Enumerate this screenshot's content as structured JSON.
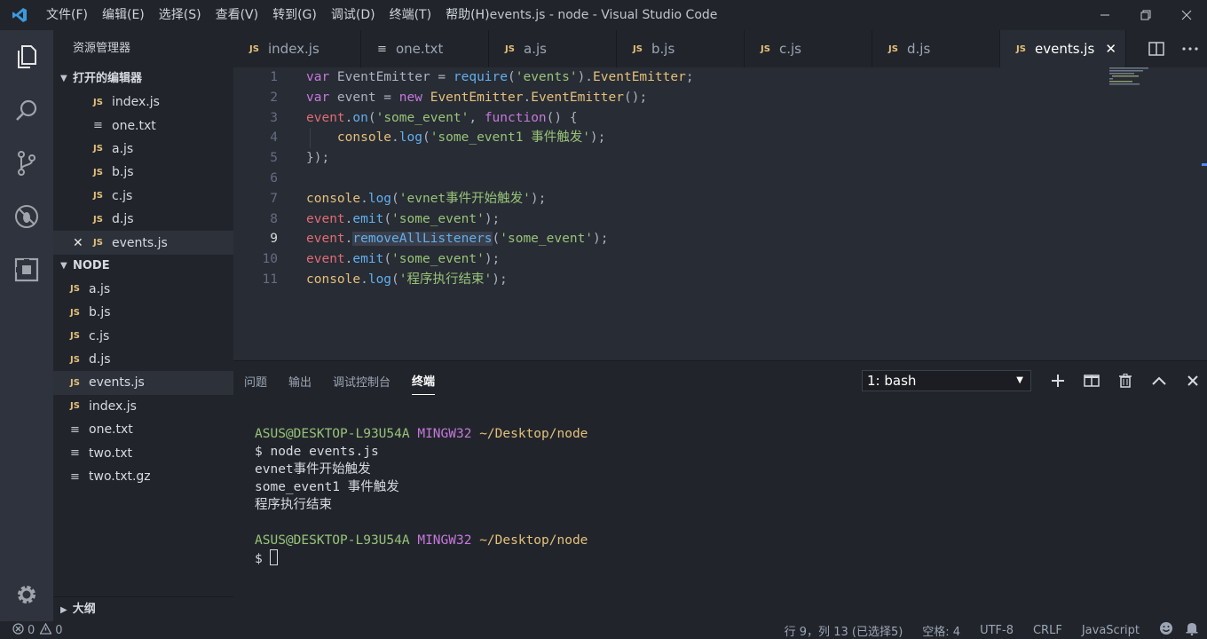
{
  "window": {
    "title": "events.js - node - Visual Studio Code",
    "menu": [
      "文件(F)",
      "编辑(E)",
      "选择(S)",
      "查看(V)",
      "转到(G)",
      "调试(D)",
      "终端(T)",
      "帮助(H)"
    ]
  },
  "sidebar": {
    "title": "资源管理器",
    "open_editors_label": "打开的编辑器",
    "open_editors": [
      {
        "label": "index.js",
        "type": "js"
      },
      {
        "label": "one.txt",
        "type": "txt"
      },
      {
        "label": "a.js",
        "type": "js"
      },
      {
        "label": "b.js",
        "type": "js"
      },
      {
        "label": "c.js",
        "type": "js"
      },
      {
        "label": "d.js",
        "type": "js"
      },
      {
        "label": "events.js",
        "type": "js"
      }
    ],
    "folder_label": "NODE",
    "files": [
      {
        "label": "a.js",
        "type": "js"
      },
      {
        "label": "b.js",
        "type": "js"
      },
      {
        "label": "c.js",
        "type": "js"
      },
      {
        "label": "d.js",
        "type": "js"
      },
      {
        "label": "events.js",
        "type": "js"
      },
      {
        "label": "index.js",
        "type": "js"
      },
      {
        "label": "one.txt",
        "type": "txt"
      },
      {
        "label": "two.txt",
        "type": "txt"
      },
      {
        "label": "two.txt.gz",
        "type": "txt"
      }
    ],
    "outline_label": "大纲"
  },
  "tabs": [
    {
      "label": "index.js",
      "type": "js"
    },
    {
      "label": "one.txt",
      "type": "txt"
    },
    {
      "label": "a.js",
      "type": "js"
    },
    {
      "label": "b.js",
      "type": "js"
    },
    {
      "label": "c.js",
      "type": "js"
    },
    {
      "label": "d.js",
      "type": "js"
    },
    {
      "label": "events.js",
      "type": "js",
      "active": true
    }
  ],
  "badges": {
    "js": "JS",
    "txt": "≡"
  },
  "editor": {
    "current_line": 9,
    "line_numbers": [
      "1",
      "2",
      "3",
      "4",
      "5",
      "6",
      "7",
      "8",
      "9",
      "10",
      "11"
    ]
  },
  "panel": {
    "tabs": [
      "问题",
      "输出",
      "调试控制台",
      "终端"
    ],
    "active_tab": "终端",
    "terminal_select": "1: bash",
    "terminal_lines": {
      "user": "ASUS@DESKTOP-L93U54A",
      "host": "MINGW32",
      "path": "~/Desktop/node",
      "cmd": "$ node events.js",
      "out1": "evnet事件开始触发",
      "out2": "some_event1 事件触发",
      "out3": "程序执行结束",
      "prompt": "$ "
    }
  },
  "statusbar": {
    "errors": "0",
    "warnings": "0",
    "position": "行 9，列 13 (已选择5)",
    "spaces": "空格: 4",
    "encoding": "UTF-8",
    "eol": "CRLF",
    "language": "JavaScript"
  },
  "colors": {
    "accent": "#528bff",
    "js_badge": "#e5c07b",
    "keyword": "#c678dd",
    "function": "#61afef",
    "string": "#98c379"
  }
}
